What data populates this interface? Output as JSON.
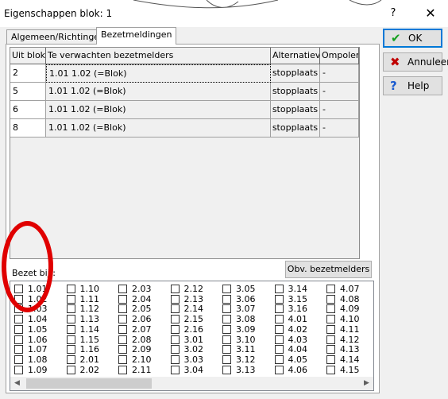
{
  "window": {
    "title": "Eigenschappen blok: 1",
    "help_glyph": "?",
    "close_glyph": "✕"
  },
  "tabs": [
    {
      "label": "Algemeen/Richtingen",
      "active": false
    },
    {
      "label": "Bezetmeldingen",
      "active": true
    }
  ],
  "grid": {
    "headers": [
      "Uit blok",
      "Te verwachten bezetmelders",
      "Alternatieve",
      "Ompolen"
    ],
    "rows": [
      {
        "uit_blok": "2",
        "bezetmelders": "1.01  1.02 (=Blok)",
        "alternatieve": "stopplaats",
        "ompolen": "-"
      },
      {
        "uit_blok": "5",
        "bezetmelders": "1.01  1.02 (=Blok)",
        "alternatieve": "stopplaats",
        "ompolen": "-"
      },
      {
        "uit_blok": "6",
        "bezetmelders": "1.01  1.02 (=Blok)",
        "alternatieve": "stopplaats",
        "ompolen": "-"
      },
      {
        "uit_blok": "8",
        "bezetmelders": "1.01  1.02 (=Blok)",
        "alternatieve": "stopplaats",
        "ompolen": "-"
      }
    ]
  },
  "bezet_label": "Bezet bij :",
  "obv_button": "Obv. bezetmelders",
  "checkbox_columns": [
    [
      "1.01",
      "1.02",
      "1.03",
      "1.04",
      "1.05",
      "1.06",
      "1.07",
      "1.08",
      "1.09"
    ],
    [
      "1.10",
      "1.11",
      "1.12",
      "1.13",
      "1.14",
      "1.15",
      "1.16",
      "2.01",
      "2.02"
    ],
    [
      "2.03",
      "2.04",
      "2.05",
      "2.06",
      "2.07",
      "2.08",
      "2.09",
      "2.10",
      "2.11"
    ],
    [
      "2.12",
      "2.13",
      "2.14",
      "2.15",
      "2.16",
      "3.01",
      "3.02",
      "3.03",
      "3.04"
    ],
    [
      "3.05",
      "3.06",
      "3.07",
      "3.08",
      "3.09",
      "3.10",
      "3.11",
      "3.12",
      "3.13"
    ],
    [
      "3.14",
      "3.15",
      "3.16",
      "4.01",
      "4.02",
      "4.03",
      "4.04",
      "4.05",
      "4.06"
    ],
    [
      "4.07",
      "4.08",
      "4.09",
      "4.10",
      "4.11",
      "4.12",
      "4.13",
      "4.14",
      "4.15"
    ]
  ],
  "buttons": {
    "ok": "OK",
    "cancel": "Annuleer",
    "help": "Help"
  },
  "icons": {
    "ok": "checkmark-icon",
    "cancel": "x-icon",
    "help": "question-icon"
  },
  "colors": {
    "ok_icon": "#14a01e",
    "cancel_icon": "#c00000",
    "help_icon": "#1a5ad0",
    "highlight": "#e00000",
    "focus_border": "#0078d7"
  }
}
